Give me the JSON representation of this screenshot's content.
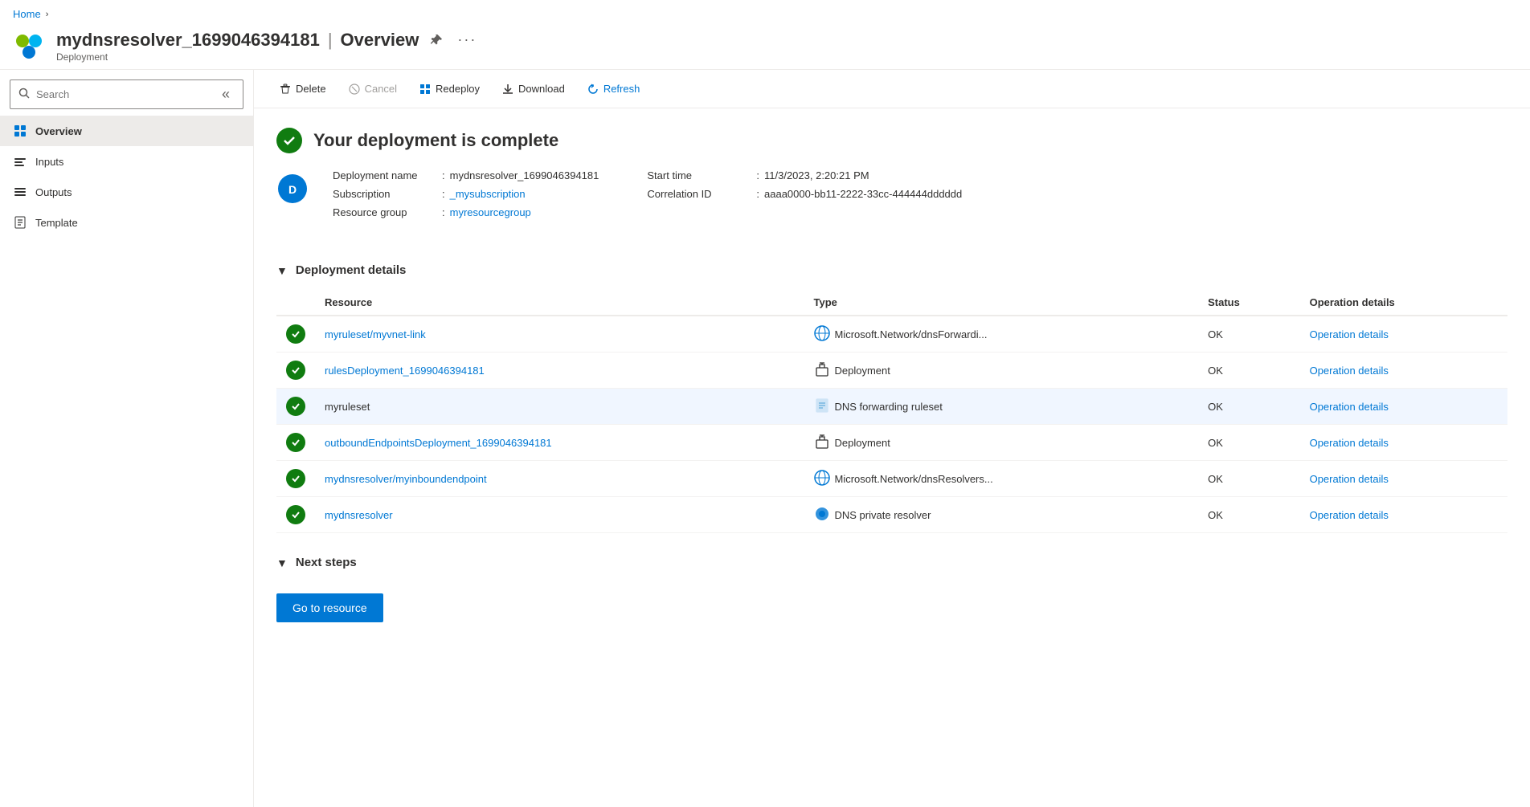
{
  "breadcrumb": {
    "home": "Home"
  },
  "header": {
    "title": "mydnsresolver_1699046394181",
    "separator": "|",
    "page": "Overview",
    "subtitle": "Deployment",
    "pin_label": "Pin",
    "more_label": "More options"
  },
  "sidebar": {
    "search_placeholder": "Search",
    "collapse_label": "Collapse",
    "nav_items": [
      {
        "id": "overview",
        "label": "Overview",
        "active": true
      },
      {
        "id": "inputs",
        "label": "Inputs",
        "active": false
      },
      {
        "id": "outputs",
        "label": "Outputs",
        "active": false
      },
      {
        "id": "template",
        "label": "Template",
        "active": false
      }
    ]
  },
  "toolbar": {
    "delete_label": "Delete",
    "cancel_label": "Cancel",
    "redeploy_label": "Redeploy",
    "download_label": "Download",
    "refresh_label": "Refresh"
  },
  "overview": {
    "success_message": "Your deployment is complete",
    "deployment_info": {
      "name_label": "Deployment name",
      "name_value": "mydnsresolver_1699046394181",
      "subscription_label": "Subscription",
      "subscription_value": "_mysubscription",
      "resource_group_label": "Resource group",
      "resource_group_value": "myresourcegroup",
      "start_time_label": "Start time",
      "start_time_value": "11/3/2023, 2:20:21 PM",
      "correlation_id_label": "Correlation ID",
      "correlation_id_value": "aaaa0000-bb11-2222-33cc-444444dddddd"
    },
    "deployment_details": {
      "section_title": "Deployment details",
      "table_headers": [
        "Resource",
        "Type",
        "Status",
        "Operation details"
      ],
      "rows": [
        {
          "resource": "myruleset/myvnet-link",
          "resource_link": true,
          "type_icon": "network",
          "type": "Microsoft.Network/dnsForwardi...",
          "status": "OK",
          "operation": "Operation details",
          "highlighted": false
        },
        {
          "resource": "rulesDeployment_1699046394181",
          "resource_link": true,
          "type_icon": "deployment",
          "type": "Deployment",
          "status": "OK",
          "operation": "Operation details",
          "highlighted": false
        },
        {
          "resource": "myruleset",
          "resource_link": false,
          "type_icon": "document",
          "type": "DNS forwarding ruleset",
          "status": "OK",
          "operation": "Operation details",
          "highlighted": true
        },
        {
          "resource": "outboundEndpointsDeployment_1699046394181",
          "resource_link": true,
          "type_icon": "deployment",
          "type": "Deployment",
          "status": "OK",
          "operation": "Operation details",
          "highlighted": false
        },
        {
          "resource": "mydnsresolver/myinboundendpoint",
          "resource_link": true,
          "type_icon": "network",
          "type": "Microsoft.Network/dnsResolvers...",
          "status": "OK",
          "operation": "Operation details",
          "highlighted": false
        },
        {
          "resource": "mydnsresolver",
          "resource_link": true,
          "type_icon": "dns",
          "type": "DNS private resolver",
          "status": "OK",
          "operation": "Operation details",
          "highlighted": false
        }
      ]
    },
    "next_steps": {
      "section_title": "Next steps",
      "go_to_resource_label": "Go to resource"
    }
  }
}
